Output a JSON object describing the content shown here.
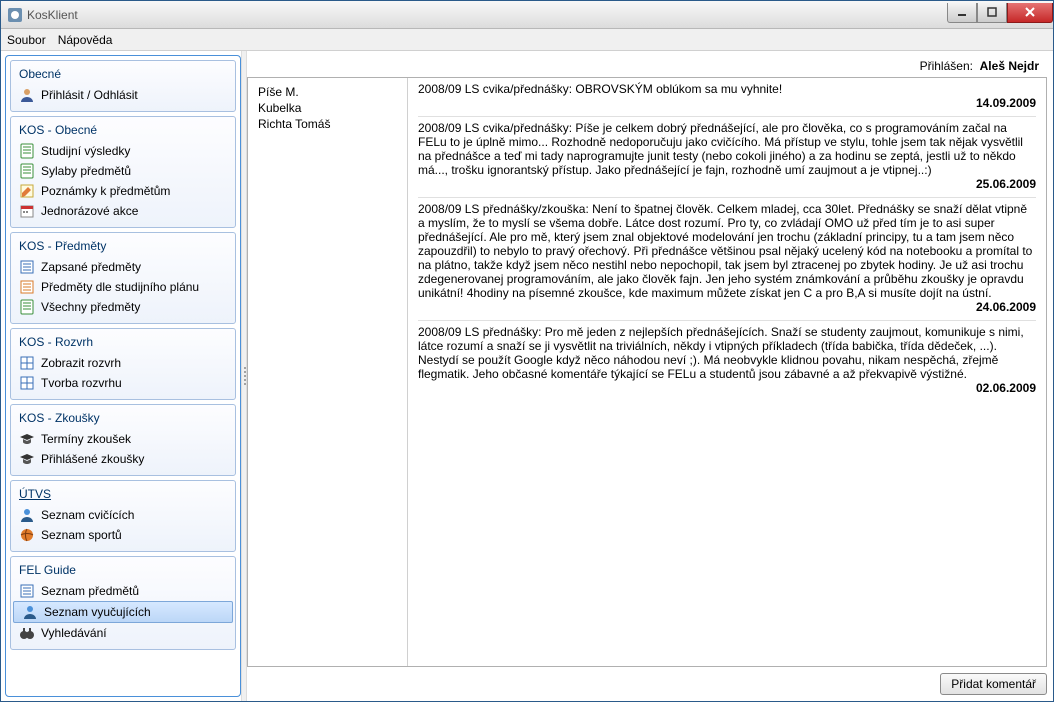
{
  "window": {
    "title": "KosKlient"
  },
  "menu": {
    "file": "Soubor",
    "help": "Nápověda"
  },
  "login": {
    "label": "Přihlášen:",
    "user": "Aleš Nejdr"
  },
  "sidebar": {
    "sections": [
      {
        "title": "Obecné",
        "items": [
          {
            "id": "login",
            "label": "Přihlásit / Odhlásit",
            "icon": "person"
          }
        ]
      },
      {
        "title": "KOS - Obecné",
        "items": [
          {
            "id": "grades",
            "label": "Studijní výsledky",
            "icon": "sheet-green"
          },
          {
            "id": "syllabi",
            "label": "Sylaby předmětů",
            "icon": "sheet-teal"
          },
          {
            "id": "notes",
            "label": "Poznámky k předmětům",
            "icon": "note"
          },
          {
            "id": "events",
            "label": "Jednorázové akce",
            "icon": "calendar"
          }
        ]
      },
      {
        "title": "KOS - Předměty",
        "items": [
          {
            "id": "enrolled",
            "label": "Zapsané předměty",
            "icon": "list-blue"
          },
          {
            "id": "plan",
            "label": "Předměty dle studijního plánu",
            "icon": "list-orange"
          },
          {
            "id": "all-subj",
            "label": "Všechny předměty",
            "icon": "sheet-green2"
          }
        ]
      },
      {
        "title": "KOS - Rozvrh",
        "items": [
          {
            "id": "show-sched",
            "label": "Zobrazit rozvrh",
            "icon": "grid"
          },
          {
            "id": "make-sched",
            "label": "Tvorba rozvrhu",
            "icon": "grid-pencil"
          }
        ]
      },
      {
        "title": "KOS - Zkoušky",
        "items": [
          {
            "id": "exam-dates",
            "label": "Termíny zkoušek",
            "icon": "cap"
          },
          {
            "id": "my-exams",
            "label": "Přihlášené zkoušky",
            "icon": "cap"
          }
        ]
      },
      {
        "title": "ÚTVS",
        "underline": true,
        "items": [
          {
            "id": "instructors",
            "label": "Seznam cvičících",
            "icon": "person-blue"
          },
          {
            "id": "sports",
            "label": "Seznam sportů",
            "icon": "ball"
          }
        ]
      },
      {
        "title": "FEL Guide",
        "items": [
          {
            "id": "subjects-list",
            "label": "Seznam předmětů",
            "icon": "list-small"
          },
          {
            "id": "teachers-list",
            "label": "Seznam vyučujících",
            "icon": "person-blue",
            "selected": true
          },
          {
            "id": "search",
            "label": "Vyhledávání",
            "icon": "binoculars"
          }
        ]
      }
    ]
  },
  "people": [
    "Píše M.",
    "Kubelka",
    "Richta Tomáš"
  ],
  "comments": [
    {
      "title": "2008/09 LS cvika/přednášky: OBROVSKÝM oblúkom sa mu vyhnite!",
      "date": "14.09.2009",
      "body": ""
    },
    {
      "title": "",
      "date": "25.06.2009",
      "body": "2008/09 LS cvika/přednášky: Píše je celkem dobrý přednášející, ale pro člověka, co s programováním začal na FELu to je úplně mimo... Rozhodně nedoporučuju jako cvičícího. Má přístup ve stylu, tohle jsem tak nějak vysvětlil na přednášce a teď mi tady naprogramujte junit testy (nebo cokoli jiného) a za hodinu se zeptá, jestli už to někdo má..., trošku ignorantský přístup. Jako přednášející je fajn, rozhodně umí zaujmout a je vtipnej..:)"
    },
    {
      "title": "",
      "date": "24.06.2009",
      "body": "2008/09 LS přednášky/zkouška: Není to špatnej člověk. Celkem mladej, cca 30let. Přednášky se snaží dělat vtipně a myslím, že to myslí se všema dobře. Látce dost rozumí. Pro ty, co zvládají OMO už před tím je to asi super přednášející. Ale pro mě, který jsem znal objektové modelování jen trochu (základní principy, tu a tam jsem něco zapouzdřil) to nebylo to pravý ořechový. Při přednášce většinou psal nějaký ucelený kód na notebooku a promítal to na plátno, takže když jsem něco nestihl nebo nepochopil, tak jsem byl ztracenej po zbytek hodiny. Je už asi trochu zdegenerovanej programováním, ale jako člověk fajn. Jen jeho systém známkování a průběhu zkoušky je opravdu unikátní! 4hodiny na písemné zkoušce, kde maximum můžete získat jen C a pro B,A si musíte dojít na ústní."
    },
    {
      "title": "",
      "date": "02.06.2009",
      "body": "2008/09 LS přednášky: Pro mě jeden z nejlepších přednášejících. Snaží se studenty zaujmout, komunikuje s nimi, látce rozumí a snaží se ji vysvětlit na triviálních, někdy i vtipných příkladech (třída babička, třída dědeček, ...). Nestydí se použít Google když něco náhodou neví ;). Má neobvykle klidnou povahu, nikam nespěchá, zřejmě flegmatik. Jeho občasné komentáře týkající se FELu a studentů jsou zábavné a až překvapivě výstižné."
    }
  ],
  "buttons": {
    "add_comment": "Přidat komentář"
  }
}
